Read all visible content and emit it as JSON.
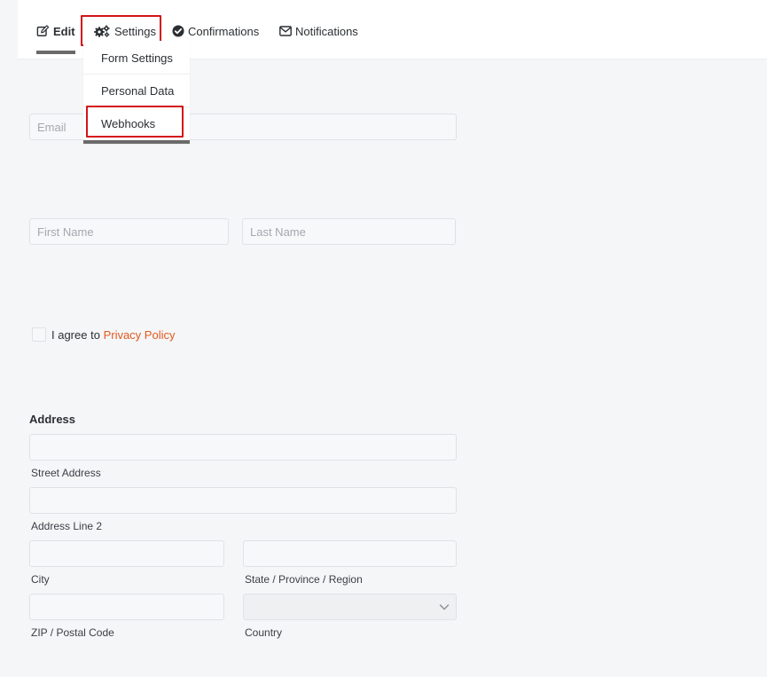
{
  "tabs": {
    "edit": "Edit",
    "settings": "Settings",
    "confirmations": "Confirmations",
    "notifications": "Notifications"
  },
  "settings_menu": {
    "items": [
      "Form Settings",
      "Personal Data",
      "Webhooks"
    ]
  },
  "form": {
    "email_placeholder": "Email",
    "first_name_placeholder": "First Name",
    "last_name_placeholder": "Last Name",
    "consent_text": "I agree to",
    "privacy_link": "Privacy Policy",
    "address_label": "Address",
    "street_label": "Street Address",
    "line2_label": "Address Line 2",
    "city_label": "City",
    "state_label": "State / Province / Region",
    "zip_label": "ZIP / Postal Code",
    "country_label": "Country"
  },
  "colors": {
    "highlight": "#d3131a",
    "link": "#e25a1c",
    "active_underline": "#6a6a6a"
  }
}
